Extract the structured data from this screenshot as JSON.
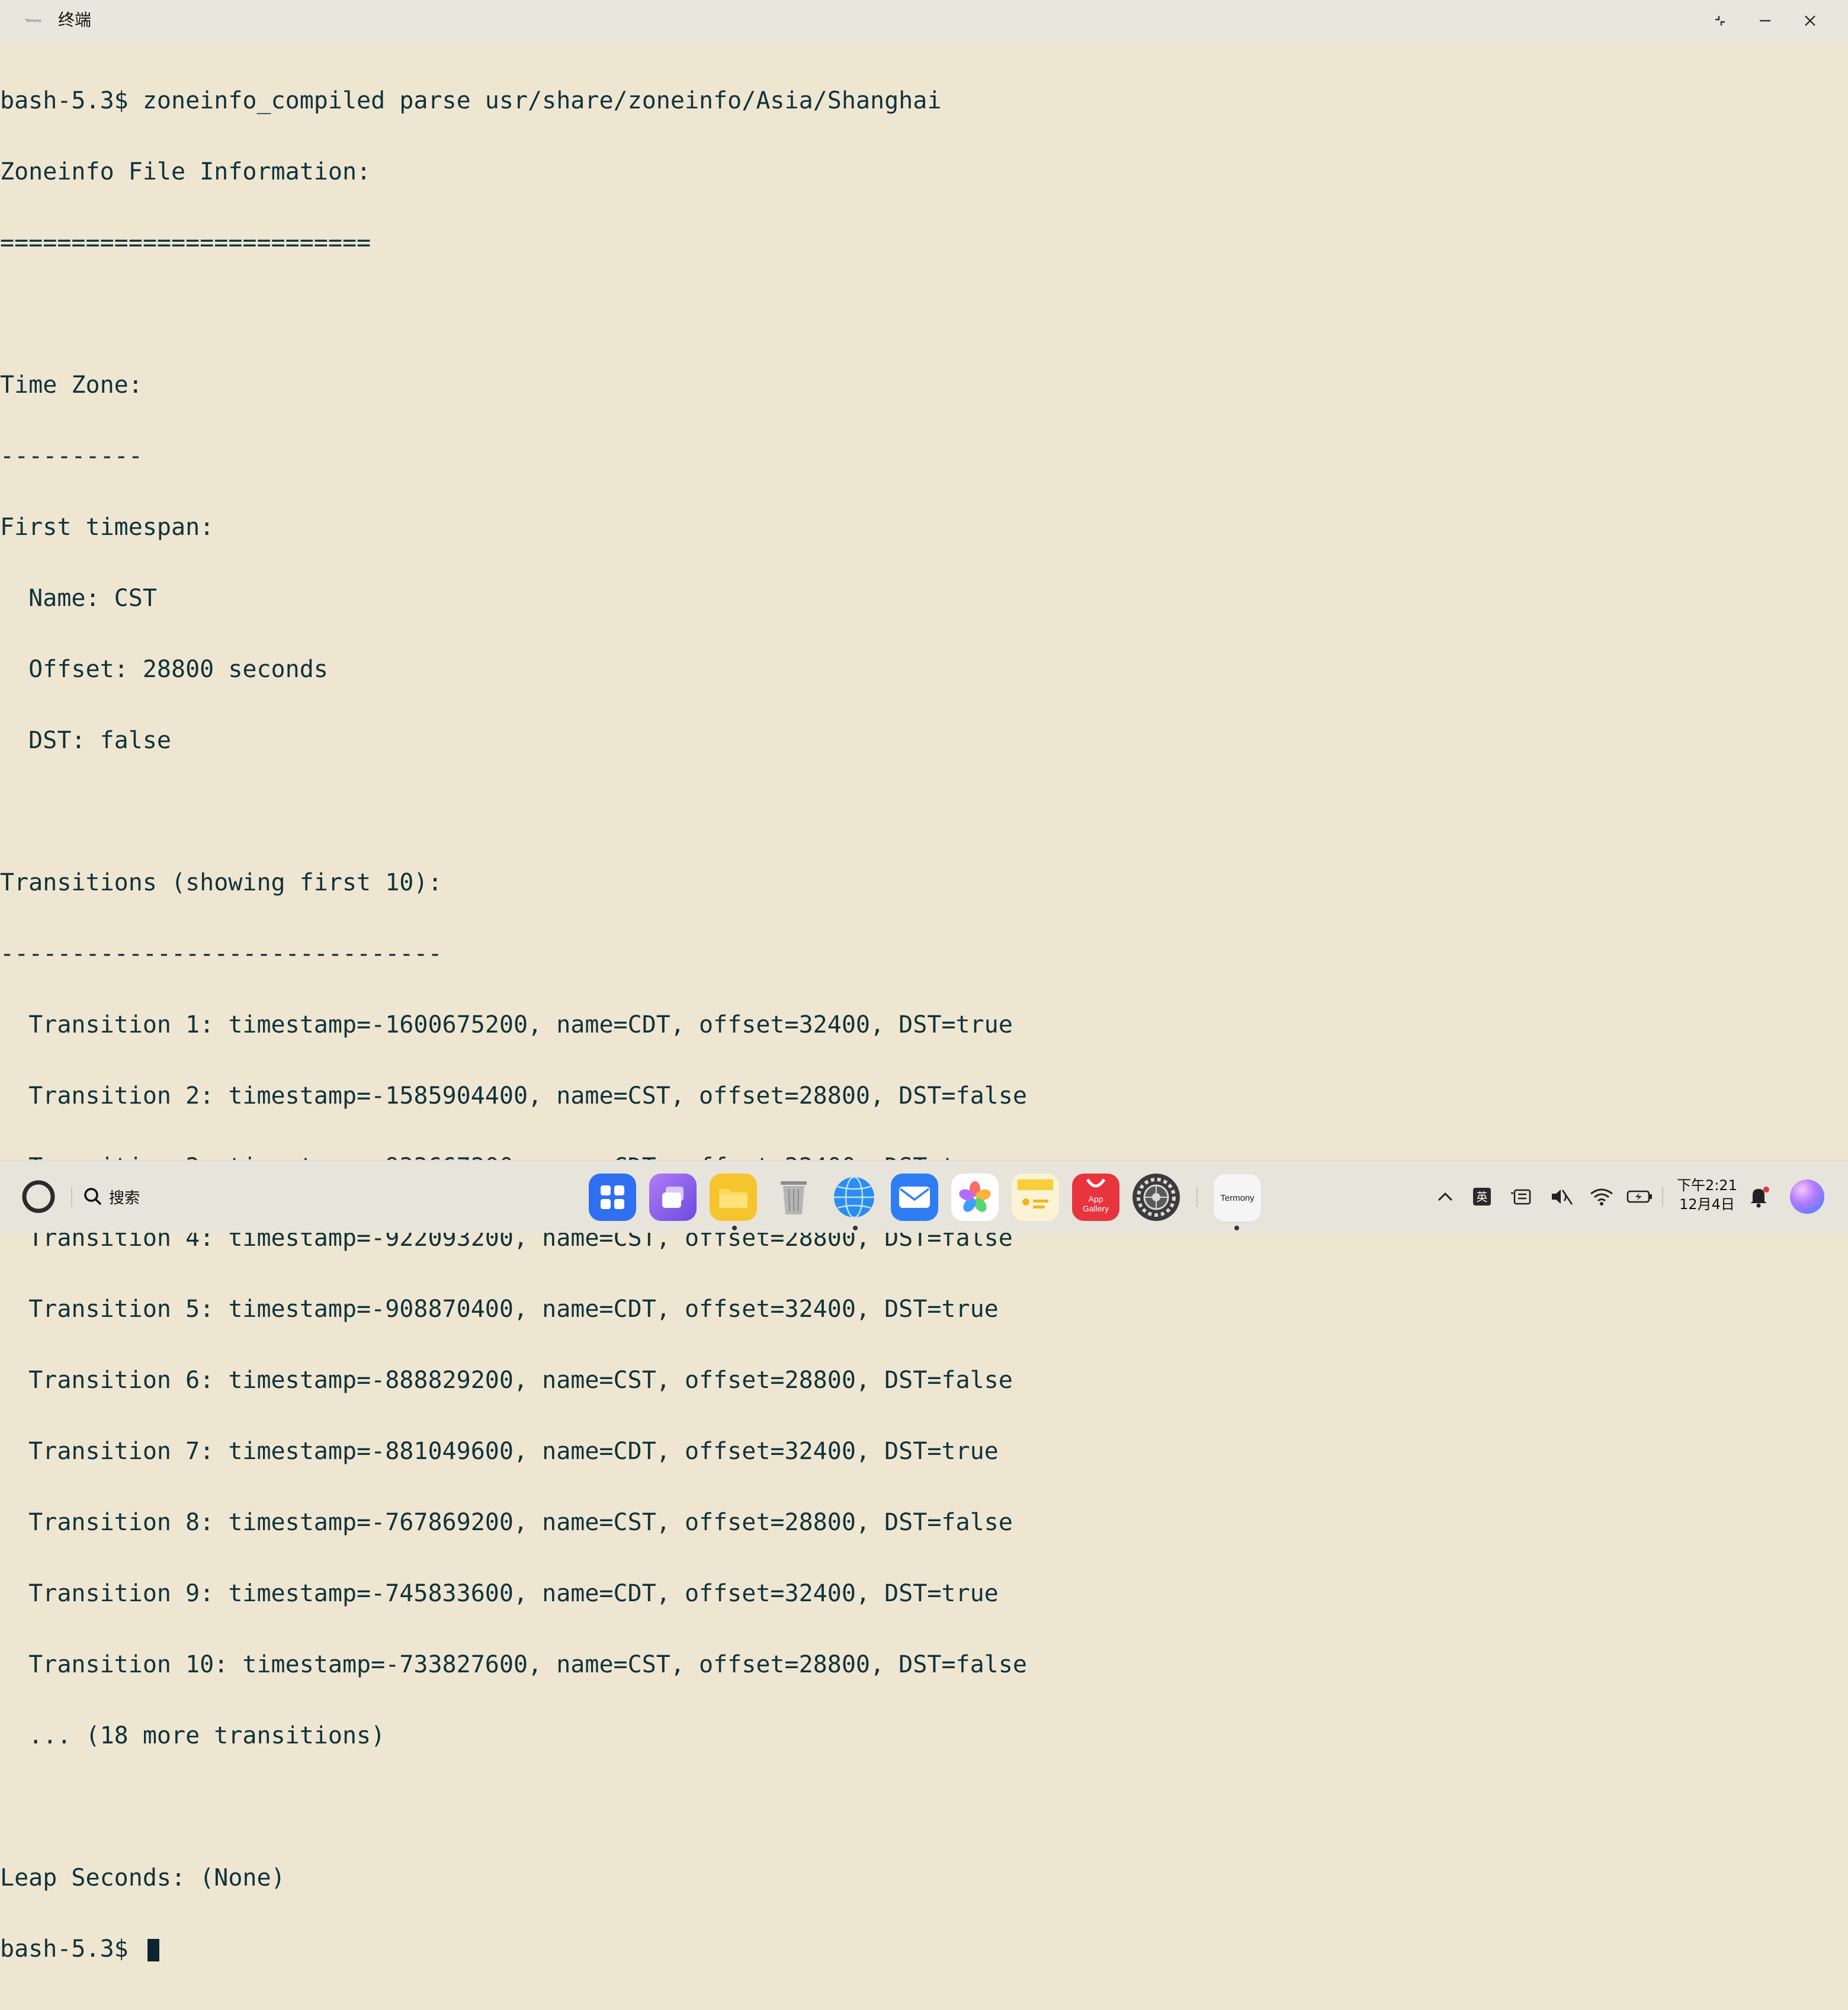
{
  "window": {
    "title": "终端",
    "app_icon_label": "Termony",
    "controls": [
      "restore",
      "minimize",
      "close"
    ]
  },
  "terminal": {
    "lines": [
      "bash-5.3$ zoneinfo_compiled parse usr/share/zoneinfo/Asia/Shanghai",
      "Zoneinfo File Information:",
      "==========================",
      "",
      "Time Zone:",
      "----------",
      "First timespan:",
      "  Name: CST",
      "  Offset: 28800 seconds",
      "  DST: false",
      "",
      "Transitions (showing first 10):",
      "-------------------------------",
      "  Transition 1: timestamp=-1600675200, name=CDT, offset=32400, DST=true",
      "  Transition 2: timestamp=-1585904400, name=CST, offset=28800, DST=false",
      "  Transition 3: timestamp=-933667200, name=CDT, offset=32400, DST=true",
      "  Transition 4: timestamp=-922093200, name=CST, offset=28800, DST=false",
      "  Transition 5: timestamp=-908870400, name=CDT, offset=32400, DST=true",
      "  Transition 6: timestamp=-888829200, name=CST, offset=28800, DST=false",
      "  Transition 7: timestamp=-881049600, name=CDT, offset=32400, DST=true",
      "  Transition 8: timestamp=-767869200, name=CST, offset=28800, DST=false",
      "  Transition 9: timestamp=-745833600, name=CDT, offset=32400, DST=true",
      "  Transition 10: timestamp=-733827600, name=CST, offset=28800, DST=false",
      "  ... (18 more transitions)",
      "",
      "Leap Seconds: (None)"
    ],
    "prompt": "bash-5.3$ "
  },
  "taskbar": {
    "search_label": "搜索",
    "dock_apps": [
      {
        "name": "app-grid",
        "color": "#2f6ff0"
      },
      {
        "name": "multitask",
        "color": "#8a5cf0"
      },
      {
        "name": "files",
        "color": "#f6c42c"
      },
      {
        "name": "trash",
        "color": "#b9b9b9"
      },
      {
        "name": "browser",
        "color": "#2a8df0"
      },
      {
        "name": "mail",
        "color": "#2f7df2"
      },
      {
        "name": "photos",
        "color": "#ffffff"
      },
      {
        "name": "notes",
        "color": "#f9d94a"
      },
      {
        "name": "app-gallery",
        "color": "#e8343d"
      },
      {
        "name": "settings",
        "color": "#4a4a4a"
      },
      {
        "name": "termony",
        "color": "#f2f2f2"
      }
    ],
    "app_gallery_label": "App\nGallery",
    "termony_label": "Termony",
    "ime_label": "英",
    "clock_time": "下午2:21",
    "clock_date": "12月4日"
  }
}
